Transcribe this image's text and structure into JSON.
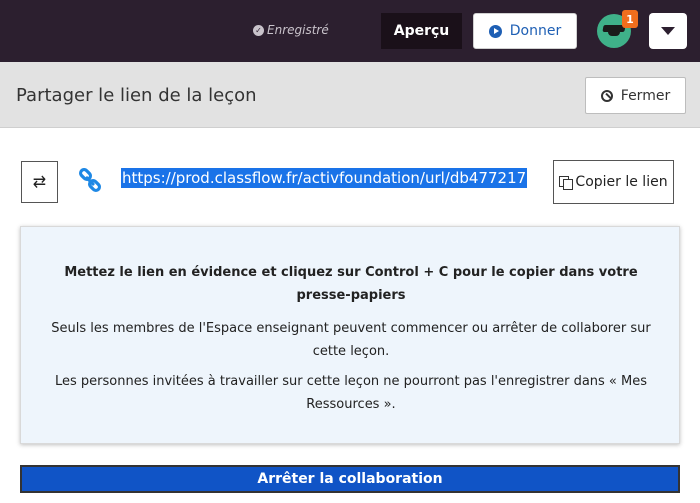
{
  "topbar": {
    "saved_status": "Enregistré",
    "preview_label": "Aperçu",
    "give_label": "Donner",
    "notification_count": "1"
  },
  "header": {
    "title": "Partager le lien de la leçon",
    "close_label": "Fermer"
  },
  "link_row": {
    "url": "https://prod.classflow.fr/activfoundation/url/db477217",
    "copy_label": "Copier le lien"
  },
  "info": {
    "instruction": "Mettez le lien en évidence et cliquez sur Control + C pour le copier dans votre presse-papiers",
    "members_note": "Seuls les membres de l'Espace enseignant peuvent commencer ou arrêter de collaborer sur cette leçon.",
    "guests_note": "Les personnes invitées à travailler sur cette leçon ne pourront pas l'enregistrer dans « Mes Ressources »."
  },
  "actions": {
    "stop_label": "Arrêter la collaboration"
  },
  "icons": {
    "saved": "check-circle-icon",
    "give": "play-circle-icon",
    "close": "ban-icon",
    "swap": "swap-arrows-icon",
    "link": "link-icon",
    "copy": "copy-icon",
    "menu": "caret-down-icon"
  },
  "colors": {
    "topbar": "#2c1f2f",
    "accent_blue": "#1054c6",
    "link_blue": "#1e5fb4",
    "badge": "#f06e1d",
    "avatar": "#3fb189",
    "info_bg": "#eef5fc"
  }
}
